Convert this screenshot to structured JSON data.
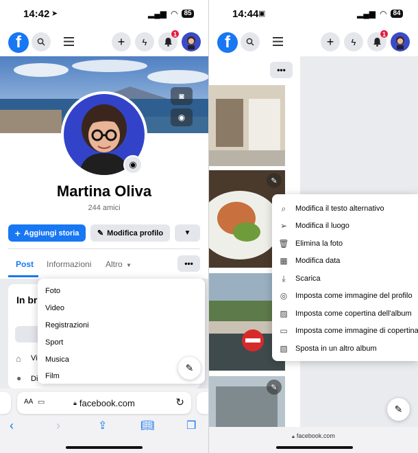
{
  "left": {
    "status": {
      "time": "14:42",
      "battery": "85"
    },
    "nav": {
      "notifications_count": "1",
      "logo": "f"
    },
    "profile": {
      "name": "Martina Oliva",
      "friends": "244 amici"
    },
    "actions": {
      "add_story": "Aggiungi storia",
      "edit_profile": "Modifica profilo"
    },
    "tabs": [
      {
        "label": "Post"
      },
      {
        "label": "Informazioni"
      },
      {
        "label": "Altro"
      }
    ],
    "intro_title": "In bre",
    "info_rows": [
      "Vi",
      "Di"
    ],
    "more_menu": [
      "Foto",
      "Video",
      "Registrazioni",
      "Sport",
      "Musica",
      "Film"
    ],
    "browser": {
      "aa": "AA",
      "url": "facebook.com"
    }
  },
  "right": {
    "status": {
      "time": "14:44",
      "battery": "84"
    },
    "nav": {
      "notifications_count": "1",
      "logo": "f"
    },
    "context_menu": [
      {
        "icon": "search-icon",
        "label": "Modifica il testo alternativo"
      },
      {
        "icon": "location-arrow-icon",
        "label": "Modifica il luogo"
      },
      {
        "icon": "trash-icon",
        "label": "Elimina la foto"
      },
      {
        "icon": "calendar-icon",
        "label": "Modifica data"
      },
      {
        "icon": "download-icon",
        "label": "Scarica"
      },
      {
        "icon": "profile-circle-icon",
        "label": "Imposta come immagine del profilo"
      },
      {
        "icon": "album-cover-icon",
        "label": "Imposta come copertina dell'album"
      },
      {
        "icon": "cover-image-icon",
        "label": "Imposta come immagine di copertina"
      },
      {
        "icon": "move-album-icon",
        "label": "Sposta in un altro album"
      }
    ],
    "browser": {
      "url": "facebook.com"
    }
  },
  "colors": {
    "accent": "#1877f2",
    "badge": "#e41e3f",
    "button_grey": "#e4e6eb"
  }
}
